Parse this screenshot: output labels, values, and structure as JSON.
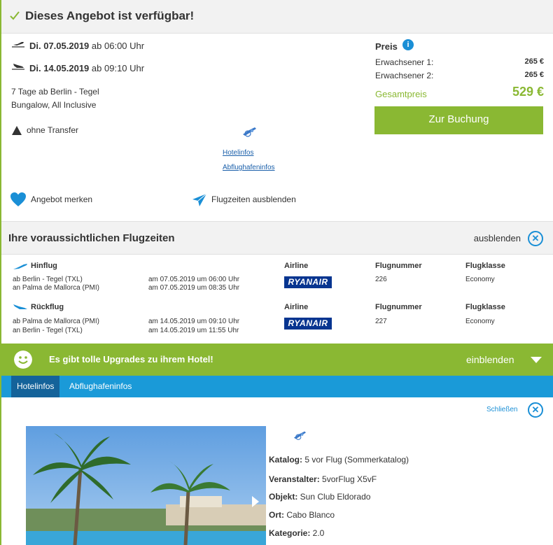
{
  "header": {
    "title": "Dieses Angebot ist verfügbar!"
  },
  "offer": {
    "outbound": {
      "date": "Di. 07.05.2019",
      "time": "ab 06:00 Uhr"
    },
    "return": {
      "date": "Di. 14.05.2019",
      "time": "ab 09:10 Uhr"
    },
    "duration": "7 Tage ab Berlin - Tegel",
    "board": "Bungalow, All Inclusive",
    "transfer": "ohne Transfer",
    "hotel_link": "Hotelinfos",
    "airport_link": "Abflughafeninfos",
    "save_label": "Angebot merken",
    "toggle_flights_label": "Flugzeiten ausblenden"
  },
  "price": {
    "label": "Preis",
    "adult1_label": "Erwachsener 1:",
    "adult1_value": "265 €",
    "adult2_label": "Erwachsener 2:",
    "adult2_value": "265 €",
    "total_label": "Gesamtpreis",
    "total_value": "529 €",
    "book_label": "Zur Buchung"
  },
  "flights": {
    "title": "Ihre voraussichtlichen Flugzeiten",
    "hide_label": "ausblenden",
    "col_airline": "Airline",
    "col_number": "Flugnummer",
    "col_class": "Flugklasse",
    "outbound": {
      "label": "Hinflug",
      "from": "ab Berlin - Tegel (TXL)",
      "to": "an Palma de Mallorca (PMI)",
      "dep": "am 07.05.2019 um 06:00 Uhr",
      "arr": "am 07.05.2019 um 08:35 Uhr",
      "airline": "RYANAIR",
      "number": "226",
      "class": "Economy"
    },
    "return": {
      "label": "Rückflug",
      "from": "ab Palma de Mallorca (PMI)",
      "to": "an Berlin - Tegel (TXL)",
      "dep": "am 14.05.2019 um 09:10 Uhr",
      "arr": "am 14.05.2019 um 11:55 Uhr",
      "airline": "RYANAIR",
      "number": "227",
      "class": "Economy"
    }
  },
  "upgrade": {
    "text": "Es gibt tolle Upgrades zu ihrem Hotel!",
    "show_label": "einblenden"
  },
  "tabs": [
    {
      "label": "Hotelinfos"
    },
    {
      "label": "Abflughafeninfos"
    }
  ],
  "hotel": {
    "close_label": "Schließen",
    "catalog_label": "Katalog:",
    "catalog_value": " 5 vor Flug (Sommerkatalog)",
    "operator_label": "Veranstalter:",
    "operator_value": " 5vorFlug X5vF",
    "object_label": "Objekt:",
    "object_value": " Sun Club Eldorado",
    "place_label": "Ort:",
    "place_value": " Cabo Blanco",
    "category_label": "Kategorie:",
    "category_value": " 2.0"
  },
  "colors": {
    "accent_green": "#8ab833",
    "accent_blue": "#1a9ad8",
    "ryanair_blue": "#073590"
  }
}
